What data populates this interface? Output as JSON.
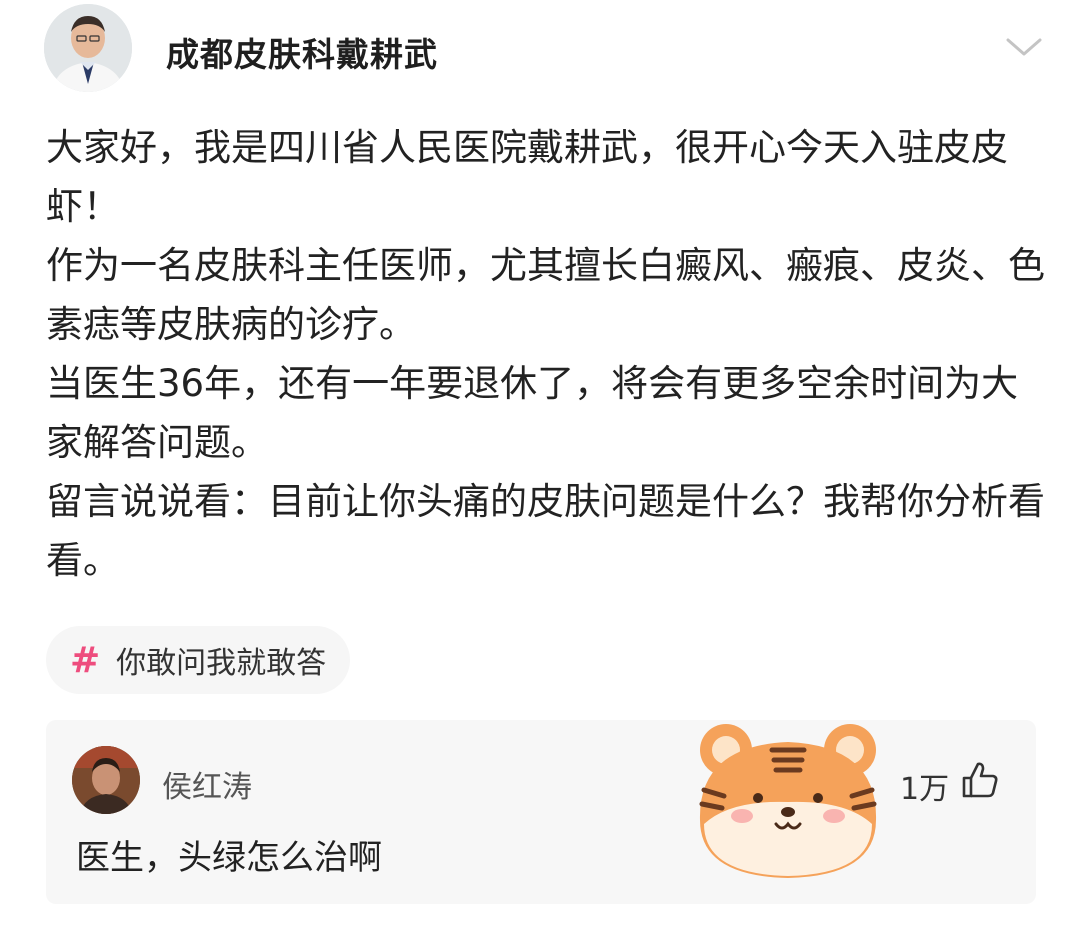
{
  "post": {
    "author_name": "成都皮肤科戴耕武",
    "paragraphs": [
      "大家好，我是四川省人民医院戴耕武，很开心今天入驻皮皮虾！",
      "作为一名皮肤科主任医师，尤其擅长白癜风、瘢痕、皮炎、色素痣等皮肤病的诊疗。",
      "当医生36年，还有一年要退休了，将会有更多空余时间为大家解答问题。",
      "留言说说看：目前让你头痛的皮肤问题是什么？我帮你分析看看。"
    ],
    "tag": {
      "symbol": "#",
      "text": "你敢问我就敢答"
    }
  },
  "comment": {
    "username": "侯红涛",
    "text": "医生，头绿怎么治啊",
    "like_count": "1万"
  },
  "colors": {
    "tag_accent": "#ee4d7e",
    "tiger_orange": "#f5a25a"
  }
}
